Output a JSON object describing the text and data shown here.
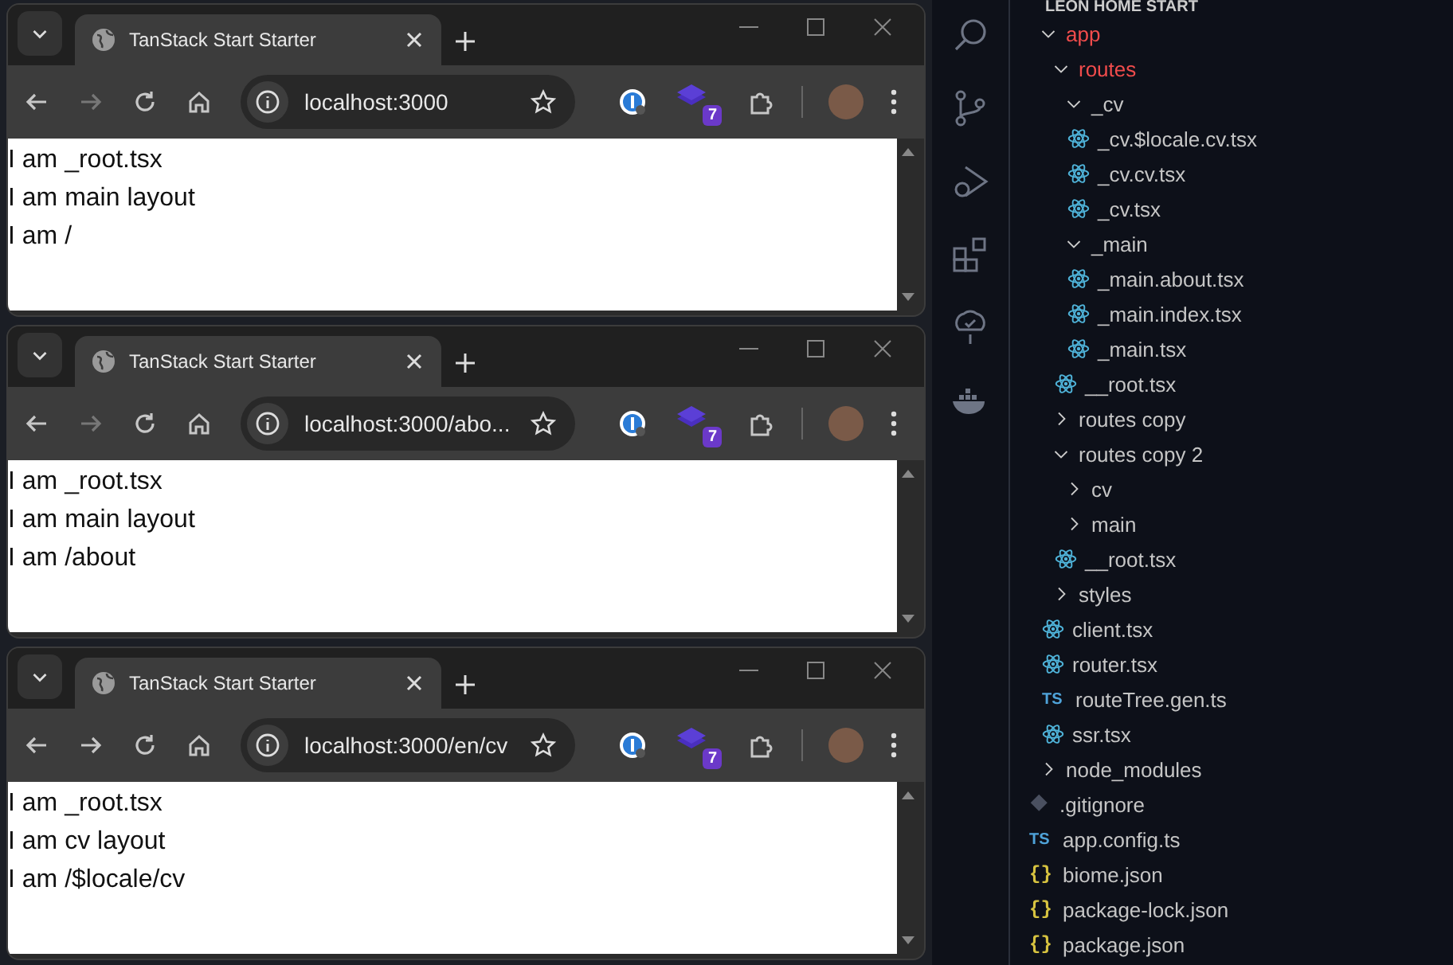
{
  "browsers": [
    {
      "tab_title": "TanStack Start Starter",
      "url": "localhost:3000",
      "forward_enabled": false,
      "extension_badge": "7",
      "lines": [
        "I am _root.tsx",
        "I am main layout",
        "I am /"
      ]
    },
    {
      "tab_title": "TanStack Start Starter",
      "url": "localhost:3000/abo...",
      "forward_enabled": false,
      "extension_badge": "7",
      "lines": [
        "I am _root.tsx",
        "I am main layout",
        "I am /about"
      ]
    },
    {
      "tab_title": "TanStack Start Starter",
      "url": "localhost:3000/en/cv",
      "forward_enabled": true,
      "extension_badge": "7",
      "lines": [
        "I am _root.tsx",
        "I am cv layout",
        "I am /$locale/cv"
      ]
    }
  ],
  "editor": {
    "activity_bar": [
      {
        "kind": "search"
      },
      {
        "kind": "source-control"
      },
      {
        "kind": "run-debug"
      },
      {
        "kind": "extensions"
      },
      {
        "kind": "testing"
      },
      {
        "kind": "docker"
      }
    ],
    "explorer_title": "LEON HOME START",
    "tree": [
      {
        "name": "app",
        "kind": "folder",
        "expanded": true,
        "color": "#f14c4c",
        "children": [
          {
            "name": "routes",
            "kind": "folder",
            "expanded": true,
            "color": "#f14c4c",
            "children": [
              {
                "name": "_cv",
                "kind": "folder",
                "expanded": true,
                "children": [
                  {
                    "name": "_cv.$locale.cv.tsx",
                    "kind": "react"
                  },
                  {
                    "name": "_cv.cv.tsx",
                    "kind": "react"
                  },
                  {
                    "name": "_cv.tsx",
                    "kind": "react"
                  }
                ]
              },
              {
                "name": "_main",
                "kind": "folder",
                "expanded": true,
                "children": [
                  {
                    "name": "_main.about.tsx",
                    "kind": "react"
                  },
                  {
                    "name": "_main.index.tsx",
                    "kind": "react"
                  },
                  {
                    "name": "_main.tsx",
                    "kind": "react"
                  }
                ]
              },
              {
                "name": "__root.tsx",
                "kind": "react"
              }
            ]
          },
          {
            "name": "routes copy",
            "kind": "folder",
            "expanded": false
          },
          {
            "name": "routes copy 2",
            "kind": "folder",
            "expanded": true,
            "children": [
              {
                "name": "cv",
                "kind": "folder",
                "expanded": false
              },
              {
                "name": "main",
                "kind": "folder",
                "expanded": false
              },
              {
                "name": "__root.tsx",
                "kind": "react"
              }
            ]
          },
          {
            "name": "styles",
            "kind": "folder",
            "expanded": false
          },
          {
            "name": "client.tsx",
            "kind": "react"
          },
          {
            "name": "router.tsx",
            "kind": "react"
          },
          {
            "name": "routeTree.gen.ts",
            "kind": "ts",
            "icon_text": "TS"
          },
          {
            "name": "ssr.tsx",
            "kind": "react"
          }
        ]
      },
      {
        "name": "node_modules",
        "kind": "folder",
        "expanded": false
      },
      {
        "name": ".gitignore",
        "kind": "git"
      },
      {
        "name": "app.config.ts",
        "kind": "ts",
        "icon_text": "TS"
      },
      {
        "name": "biome.json",
        "kind": "json",
        "icon_text": "{}"
      },
      {
        "name": "package-lock.json",
        "kind": "json",
        "icon_text": "{}"
      },
      {
        "name": "package.json",
        "kind": "json",
        "icon_text": "{}"
      }
    ]
  }
}
